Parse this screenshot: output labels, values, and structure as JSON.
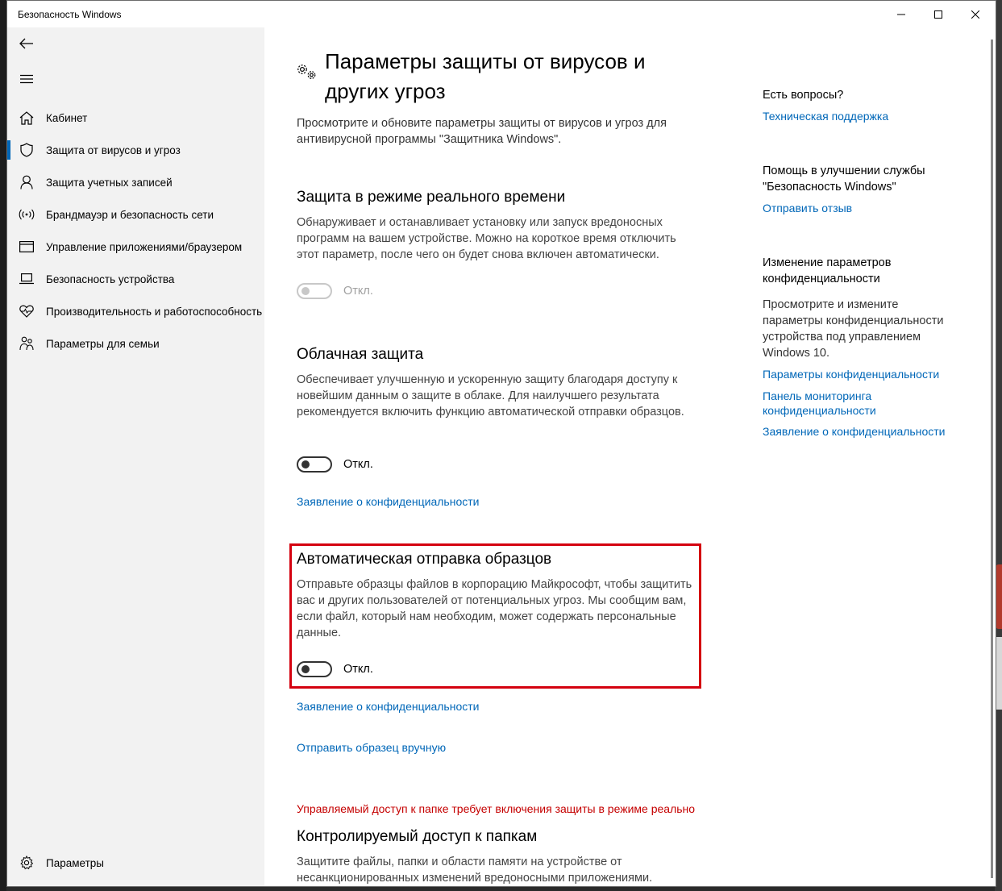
{
  "window": {
    "title": "Безопасность Windows"
  },
  "sidebar": {
    "back_icon": "back-arrow-icon",
    "menu_icon": "hamburger-icon",
    "items": [
      {
        "label": "Кабинет",
        "icon": "home-icon"
      },
      {
        "label": "Защита от вирусов и угроз",
        "icon": "shield-icon",
        "active": true
      },
      {
        "label": "Защита учетных записей",
        "icon": "person-icon"
      },
      {
        "label": "Брандмауэр и безопасность сети",
        "icon": "wifi-icon"
      },
      {
        "label": "Управление приложениями/браузером",
        "icon": "window-icon"
      },
      {
        "label": "Безопасность устройства",
        "icon": "laptop-icon"
      },
      {
        "label": "Производительность и работоспособность",
        "icon": "heart-icon"
      },
      {
        "label": "Параметры для семьи",
        "icon": "family-icon"
      }
    ],
    "settings_label": "Параметры"
  },
  "main": {
    "title": "Параметры защиты от вирусов и других угроз",
    "intro": "Просмотрите и обновите параметры защиты от вирусов и угроз для антивирусной программы \"Защитника Windows\".",
    "realtime": {
      "heading": "Защита в режиме реального времени",
      "description": "Обнаруживает и останавливает установку или запуск вредоносных программ на вашем устройстве. Можно на короткое время отключить этот параметр, после чего он будет снова включен автоматически.",
      "toggle_state": "Откл."
    },
    "cloud": {
      "heading": "Облачная защита",
      "description": "Обеспечивает улучшенную и ускоренную защиту благодаря доступу к новейшим данным о защите в облаке. Для наилучшего результата рекомендуется включить функцию автоматической отправки образцов.",
      "toggle_state": "Откл.",
      "privacy_link": "Заявление о конфиденциальности"
    },
    "samples": {
      "heading": "Автоматическая отправка образцов",
      "description": "Отправьте образцы файлов в корпорацию Майкрософт, чтобы защитить вас и других пользователей от потенциальных угроз. Мы сообщим вам, если файл, который нам необходим, может содержать персональные данные.",
      "toggle_state": "Откл.",
      "privacy_link": "Заявление о конфиденциальности",
      "manual_link": "Отправить образец вручную"
    },
    "warning": "Управляемый доступ к папке требует включения защиты в режиме реально",
    "folders": {
      "heading": "Контролируемый доступ к папкам",
      "description": "Защитите файлы, папки и области памяти на устройстве от несанкционированных изменений вредоносными приложениями."
    }
  },
  "right": {
    "questions_heading": "Есть вопросы?",
    "support_link": "Техническая поддержка",
    "improve_heading": "Помощь в улучшении службы \"Безопасность Windows\"",
    "feedback_link": "Отправить отзыв",
    "privacy_heading": "Изменение параметров конфиденциальности",
    "privacy_text": "Просмотрите и измените параметры конфиденциальности устройства под управлением Windows 10.",
    "privacy_settings_link": "Параметры конфиденциальности",
    "dashboard_link": "Панель мониторинга конфиденциальности",
    "statement_link": "Заявление о конфиденциальности"
  },
  "colors": {
    "accent": "#0067b8",
    "highlight_border": "#d4000f",
    "warning": "#c50000",
    "sidebar_bg": "#f2f2f2"
  }
}
